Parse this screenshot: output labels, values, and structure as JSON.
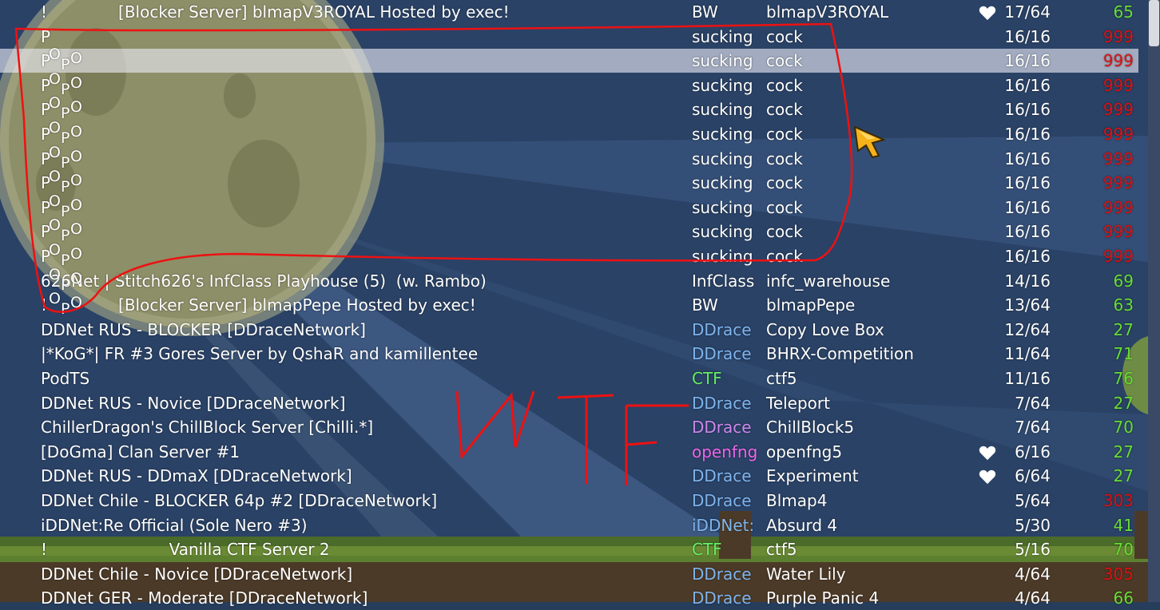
{
  "colors": {
    "gametype_default": "#ffffff",
    "gametype_ddrace": "#7fb5ee",
    "gametype_ctf": "#66ee66",
    "gametype_openfng": "#ee66ee",
    "gametype_chillblock": "#cc88ee",
    "ping_good": "#66dd33",
    "ping_bad": "#dd1111",
    "annotation": "#ee1111"
  },
  "servers": [
    {
      "name": "!              [Blocker Server] blmapV3ROYAL Hosted by exec!",
      "gametype": "BW",
      "map": "blmapV3ROYAL",
      "players": "17/64",
      "ping": "65",
      "favorite": true
    },
    {
      "name": "P",
      "gametype": "sucking",
      "map": "cock",
      "players": "16/16",
      "ping": "999",
      "favorite": false
    },
    {
      "name": "P",
      "gametype": "sucking",
      "map": "cock",
      "players": "16/16",
      "ping": "999",
      "favorite": false
    },
    {
      "name": "P",
      "gametype": "sucking",
      "map": "cock",
      "players": "16/16",
      "ping": "999",
      "favorite": false
    },
    {
      "name": "P",
      "gametype": "sucking",
      "map": "cock",
      "players": "16/16",
      "ping": "999",
      "favorite": false
    },
    {
      "name": "P",
      "gametype": "sucking",
      "map": "cock",
      "players": "16/16",
      "ping": "999",
      "favorite": false
    },
    {
      "name": "P",
      "gametype": "sucking",
      "map": "cock",
      "players": "16/16",
      "ping": "999",
      "favorite": false
    },
    {
      "name": "P",
      "gametype": "sucking",
      "map": "cock",
      "players": "16/16",
      "ping": "999",
      "favorite": false
    },
    {
      "name": "P",
      "gametype": "sucking",
      "map": "cock",
      "players": "16/16",
      "ping": "999",
      "favorite": false
    },
    {
      "name": "P",
      "gametype": "sucking",
      "map": "cock",
      "players": "16/16",
      "ping": "999",
      "favorite": false
    },
    {
      "name": "P",
      "gametype": "sucking",
      "map": "cock",
      "players": "16/16",
      "ping": "999",
      "favorite": false
    },
    {
      "name": "626Net | Stitch626's InfClass Playhouse (5)  (w. Rambo)",
      "gametype": "InfClass",
      "map": "infc_warehouse",
      "players": "14/16",
      "ping": "69",
      "favorite": false
    },
    {
      "name": "!              [Blocker Server] blmapPepe Hosted by exec!",
      "gametype": "BW",
      "map": "blmapPepe",
      "players": "13/64",
      "ping": "63",
      "favorite": false
    },
    {
      "name": "DDNet RUS - BLOCKER [DDraceNetwork]",
      "gametype": "DDrace",
      "map": "Copy Love Box",
      "players": "12/64",
      "ping": "27",
      "favorite": false
    },
    {
      "name": "|*KoG*| FR #3 Gores Server by QshaR and kamillentee",
      "gametype": "DDrace",
      "map": "BHRX-Competition",
      "players": "11/64",
      "ping": "71",
      "favorite": false
    },
    {
      "name": "PodTS",
      "gametype": "CTF",
      "map": "ctf5",
      "players": "11/16",
      "ping": "76",
      "favorite": false
    },
    {
      "name": "DDNet RUS - Novice [DDraceNetwork]",
      "gametype": "DDrace",
      "map": "Teleport",
      "players": "7/64",
      "ping": "27",
      "favorite": false
    },
    {
      "name": "ChillerDragon's ChillBlock Server [Chilli.*]",
      "gametype": "DDrace",
      "map": "ChillBlock5",
      "players": "7/64",
      "ping": "70",
      "favorite": false
    },
    {
      "name": "[DoGma] Clan Server #1",
      "gametype": "openfng",
      "map": "openfng5",
      "players": "6/16",
      "ping": "27",
      "favorite": true
    },
    {
      "name": "DDNet RUS - DDmaX [DDraceNetwork]",
      "gametype": "DDrace",
      "map": "Experiment",
      "players": "6/64",
      "ping": "27",
      "favorite": true
    },
    {
      "name": "DDNet Chile - BLOCKER 64p #2 [DDraceNetwork]",
      "gametype": "DDrace",
      "map": "Blmap4",
      "players": "5/64",
      "ping": "303",
      "favorite": false
    },
    {
      "name": "iDDNet:Re Official (Sole Nero #3)",
      "gametype": "iDDNet:",
      "map": "Absurd 4",
      "players": "5/30",
      "ping": "41",
      "favorite": false
    },
    {
      "name": "!                        Vanilla CTF Server 2",
      "gametype": "CTF",
      "map": "ctf5",
      "players": "5/16",
      "ping": "70",
      "favorite": false
    },
    {
      "name": "DDNet Chile - Novice [DDraceNetwork]",
      "gametype": "DDrace",
      "map": "Water Lily",
      "players": "4/64",
      "ping": "305",
      "favorite": false
    },
    {
      "name": "DDNet GER - Moderate [DDraceNetwork]",
      "gametype": "DDrace",
      "map": "Purple Panic 4",
      "players": "4/64",
      "ping": "66",
      "favorite": false
    }
  ],
  "popo_glyphs": [
    "O",
    "P",
    "O"
  ],
  "annotation": {
    "letters": [
      "W",
      "T",
      "F"
    ]
  }
}
